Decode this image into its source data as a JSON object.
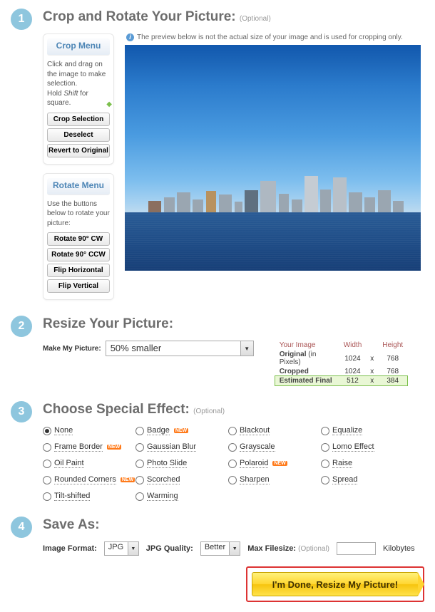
{
  "step1": {
    "title": "Crop and Rotate Your Picture:",
    "optional": "(Optional)",
    "info": "The preview below is not the actual size of your image and is used for cropping only.",
    "crop_menu_title": "Crop Menu",
    "crop_menu_desc": "Click and drag on the image to make selection.\nHold Shift for square.",
    "btn_crop": "Crop Selection",
    "btn_deselect": "Deselect",
    "btn_revert": "Revert to Original",
    "rotate_menu_title": "Rotate Menu",
    "rotate_menu_desc": "Use the buttons below to rotate your picture:",
    "btn_cw": "Rotate 90° CW",
    "btn_ccw": "Rotate 90° CCW",
    "btn_fliph": "Flip Horizontal",
    "btn_flipv": "Flip Vertical"
  },
  "step2": {
    "title": "Resize Your Picture:",
    "label": "Make My Picture:",
    "value": "50% smaller",
    "table": {
      "h_your": "Your Image",
      "h_w": "Width",
      "h_h": "Height",
      "rows": [
        {
          "label": "Original",
          "sub": "(in Pixels)",
          "w": "1024",
          "h": "768"
        },
        {
          "label": "Cropped",
          "sub": "",
          "w": "1024",
          "h": "768"
        },
        {
          "label": "Estimated Final",
          "sub": "",
          "w": "512",
          "h": "384"
        }
      ]
    }
  },
  "step3": {
    "title": "Choose Special Effect:",
    "optional": "(Optional)",
    "effects": [
      {
        "label": "None",
        "selected": true,
        "new": false
      },
      {
        "label": "Badge",
        "selected": false,
        "new": true
      },
      {
        "label": "Blackout",
        "selected": false,
        "new": false
      },
      {
        "label": "Equalize",
        "selected": false,
        "new": false
      },
      {
        "label": "Frame Border",
        "selected": false,
        "new": true
      },
      {
        "label": "Gaussian Blur",
        "selected": false,
        "new": false
      },
      {
        "label": "Grayscale",
        "selected": false,
        "new": false
      },
      {
        "label": "Lomo Effect",
        "selected": false,
        "new": false
      },
      {
        "label": "Oil Paint",
        "selected": false,
        "new": false
      },
      {
        "label": "Photo Slide",
        "selected": false,
        "new": false
      },
      {
        "label": "Polaroid",
        "selected": false,
        "new": true
      },
      {
        "label": "Raise",
        "selected": false,
        "new": false
      },
      {
        "label": "Rounded Corners",
        "selected": false,
        "new": true
      },
      {
        "label": "Scorched",
        "selected": false,
        "new": false
      },
      {
        "label": "Sharpen",
        "selected": false,
        "new": false
      },
      {
        "label": "Spread",
        "selected": false,
        "new": false
      },
      {
        "label": "Tilt-shifted",
        "selected": false,
        "new": false
      },
      {
        "label": "Warming",
        "selected": false,
        "new": false
      }
    ],
    "new_tag": "NEW"
  },
  "step4": {
    "title": "Save As:",
    "image_format_label": "Image Format:",
    "image_format_value": "JPG",
    "jpg_quality_label": "JPG Quality:",
    "jpg_quality_value": "Better",
    "max_filesize_label": "Max Filesize:",
    "max_filesize_optional": "(Optional)",
    "kilobytes": "Kilobytes",
    "done": "I'm Done, Resize My Picture!"
  }
}
